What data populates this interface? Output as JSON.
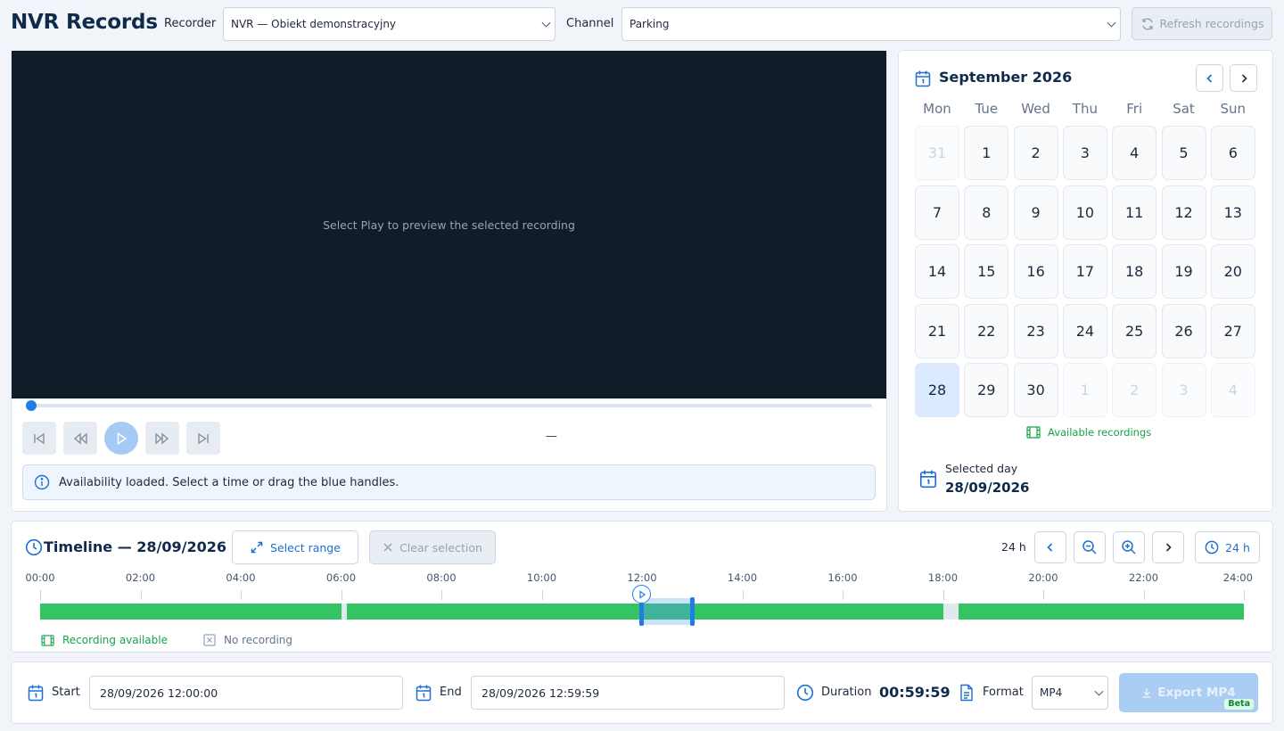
{
  "header": {
    "title": "NVR Records",
    "recorder_label": "Recorder",
    "recorder_value": "NVR — Obiekt demonstracyjny",
    "channel_label": "Channel",
    "channel_value": "Parking",
    "refresh_label": "Refresh recordings"
  },
  "player": {
    "placeholder": "Select Play to preview the selected recording",
    "progress": 0,
    "time_display": "—",
    "info": "Availability loaded. Select a time or drag the blue handles."
  },
  "calendar": {
    "month_title": "September 2026",
    "weekdays": [
      "Mon",
      "Tue",
      "Wed",
      "Thu",
      "Fri",
      "Sat",
      "Sun"
    ],
    "days": [
      {
        "d": "31",
        "other": true
      },
      {
        "d": "1"
      },
      {
        "d": "2"
      },
      {
        "d": "3"
      },
      {
        "d": "4"
      },
      {
        "d": "5"
      },
      {
        "d": "6"
      },
      {
        "d": "7"
      },
      {
        "d": "8"
      },
      {
        "d": "9"
      },
      {
        "d": "10"
      },
      {
        "d": "11"
      },
      {
        "d": "12"
      },
      {
        "d": "13"
      },
      {
        "d": "14"
      },
      {
        "d": "15"
      },
      {
        "d": "16"
      },
      {
        "d": "17"
      },
      {
        "d": "18"
      },
      {
        "d": "19"
      },
      {
        "d": "20"
      },
      {
        "d": "21"
      },
      {
        "d": "22"
      },
      {
        "d": "23"
      },
      {
        "d": "24"
      },
      {
        "d": "25"
      },
      {
        "d": "26"
      },
      {
        "d": "27"
      },
      {
        "d": "28",
        "selected": true
      },
      {
        "d": "29"
      },
      {
        "d": "30"
      },
      {
        "d": "1",
        "other": true
      },
      {
        "d": "2",
        "other": true
      },
      {
        "d": "3",
        "other": true
      },
      {
        "d": "4",
        "other": true
      }
    ],
    "legend_available": "Available recordings",
    "selected_day_label": "Selected day",
    "selected_day_value": "28/09/2026"
  },
  "timeline": {
    "title": "Timeline — 28/09/2026",
    "select_range_label": "Select range",
    "clear_selection_label": "Clear selection",
    "zoom_label": "24 h",
    "reset_label": "24 h",
    "ticks": [
      "00:00",
      "02:00",
      "04:00",
      "06:00",
      "08:00",
      "10:00",
      "12:00",
      "14:00",
      "16:00",
      "18:00",
      "20:00",
      "22:00",
      "24:00"
    ],
    "gaps_hours": [
      [
        6.0,
        6.1
      ],
      [
        18.0,
        18.3
      ]
    ],
    "selection_hours": [
      12.0,
      13.0
    ],
    "legend_recording": "Recording available",
    "legend_no_recording": "No recording",
    "colors": {
      "recording": "#35c463",
      "gap": "#e2e8f0",
      "accent": "#1d7ee8"
    }
  },
  "export": {
    "start_label": "Start",
    "start_value": "28/09/2026 12:00:00",
    "end_label": "End",
    "end_value": "28/09/2026 12:59:59",
    "duration_label": "Duration",
    "duration_value": "00:59:59",
    "format_label": "Format",
    "format_value": "MP4",
    "export_label": "Export MP4",
    "beta_badge": "Beta"
  }
}
